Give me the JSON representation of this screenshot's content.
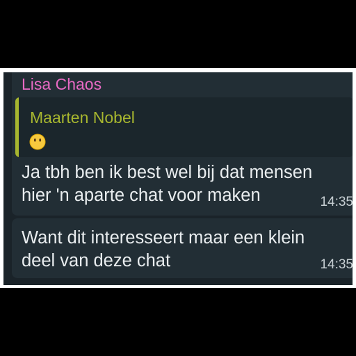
{
  "messages": [
    {
      "sender": "Lisa Chaos",
      "reply_to": {
        "author": "Maarten Nobel",
        "emoji_icon": "face-without-mouth-icon"
      },
      "lines": [
        "Ja tbh ben ik best wel bij dat mensen",
        "hier 'n aparte chat voor maken"
      ],
      "time": "14:35"
    },
    {
      "lines": [
        "Want dit interesseert maar een klein",
        "deel van deze chat"
      ],
      "time": "14:35"
    }
  ],
  "colors": {
    "sender_name": "#e86ac4",
    "quote_author": "#a7b62f",
    "bubble": "#222e35",
    "background": "#1a2329"
  }
}
